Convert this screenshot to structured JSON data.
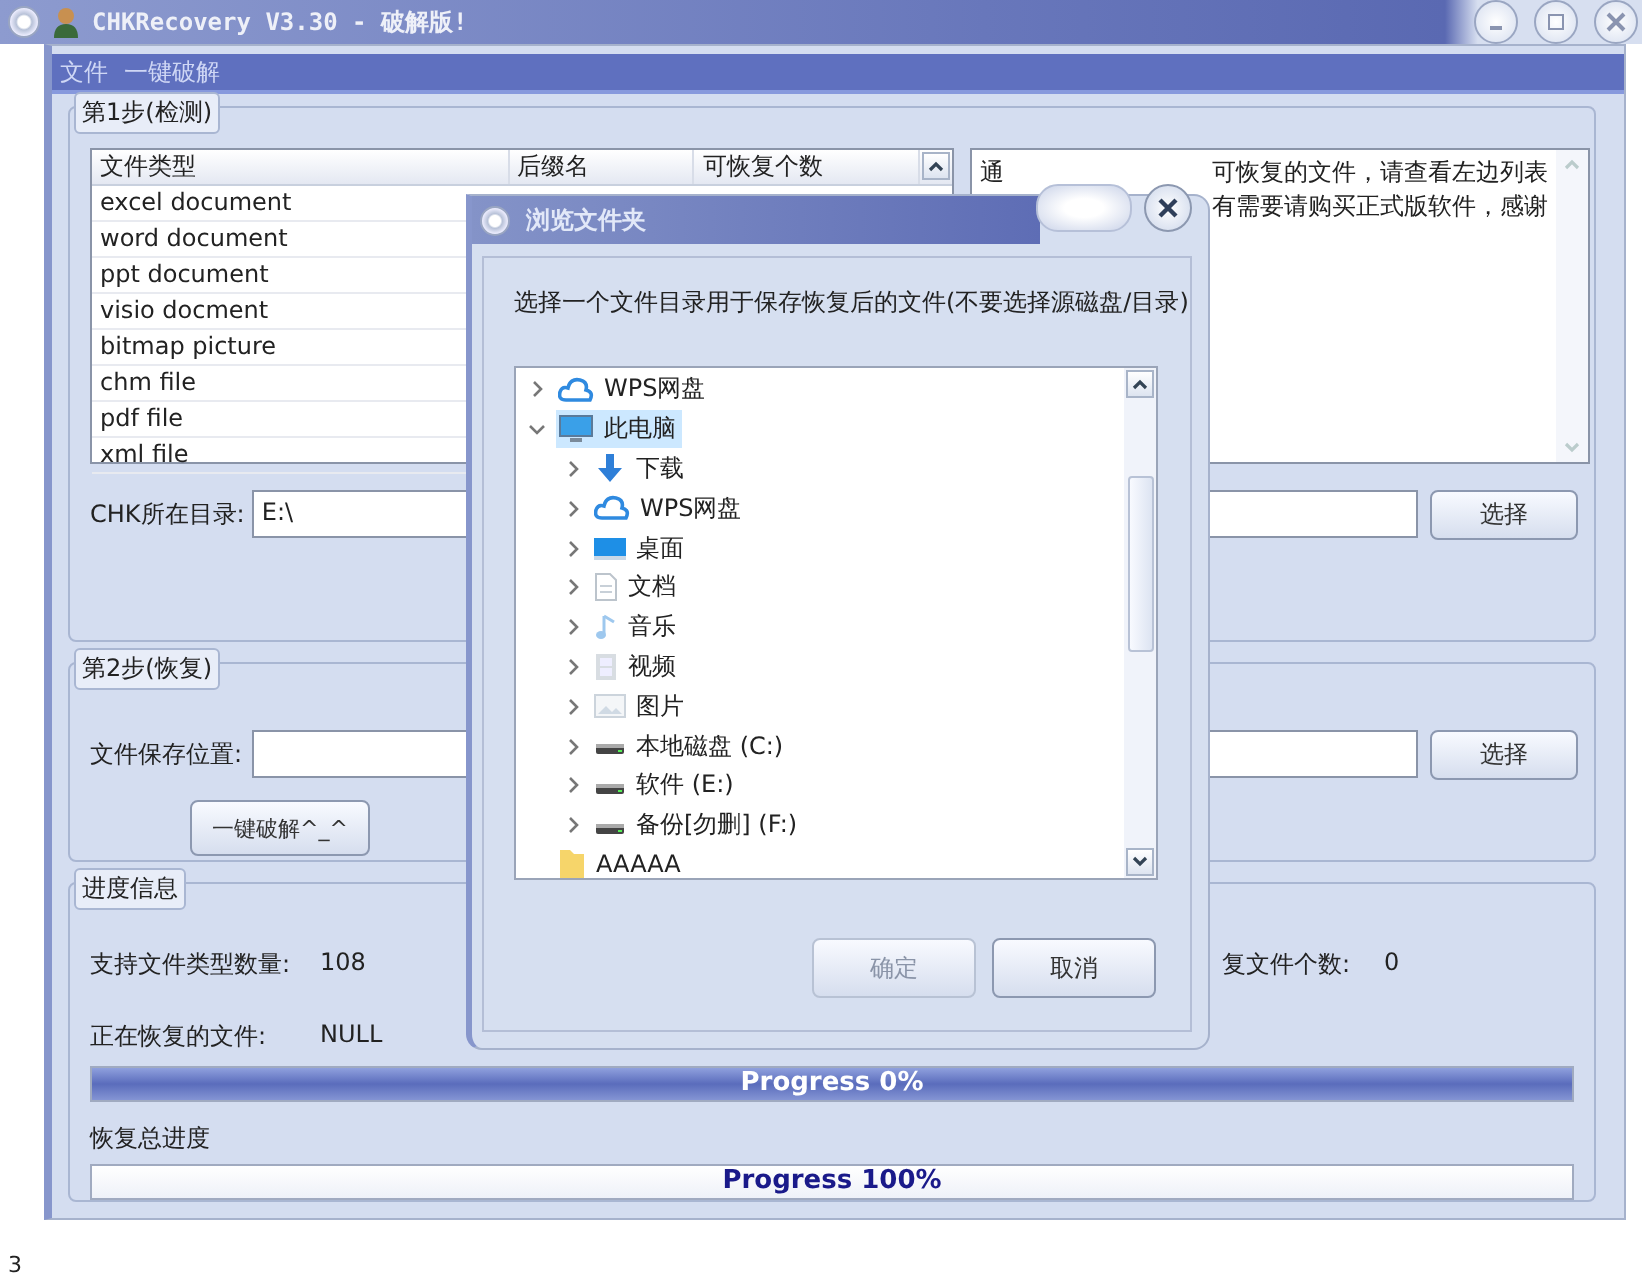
{
  "window": {
    "title": "CHKRecovery V3.30 - 破解版!"
  },
  "menu": [
    "文件",
    "一键破解"
  ],
  "step1": {
    "legend": "第1步(检测)",
    "table": {
      "columns": [
        "文件类型",
        "后缀名",
        "可恢复个数"
      ],
      "rows": [
        "excel document",
        "word document",
        "ppt document",
        "visio docment",
        "bitmap picture",
        "chm file",
        "pdf file",
        "xml file"
      ]
    },
    "info_lines": [
      {
        "left": "通",
        "right": "可恢复的文件，请查看左边列表"
      },
      {
        "right": "有需要请购买正式版软件，感谢"
      }
    ],
    "dir_label": "CHK所在目录:",
    "dir_value": "E:\\",
    "button": "选择"
  },
  "step2": {
    "legend": "第2步(恢复)",
    "save_label": "文件保存位置:",
    "button": "选择",
    "crack_button": "一键破解^_^"
  },
  "progress": {
    "legend": "进度信息",
    "types_label": "支持文件类型数量:",
    "types_value": "108",
    "count_label": "复文件个数:",
    "count_value": "0",
    "current_label": "正在恢复的文件:",
    "current_value": "NULL",
    "total_label": "恢复总进度",
    "bars": [
      {
        "text": "Progress 0%",
        "kind": "filled"
      },
      {
        "text": "Progress 100%",
        "kind": "plain"
      }
    ]
  },
  "dialog": {
    "title": "浏览文件夹",
    "prompt": "选择一个文件目录用于保存恢复后的文件(不要选择源磁盘/目录)",
    "tree": [
      {
        "label": "WPS网盘",
        "kind": "cloud",
        "expanded": false,
        "selected": false
      },
      {
        "label": "此电脑",
        "kind": "computer",
        "expanded": true,
        "selected": true,
        "children": [
          {
            "label": "下载",
            "kind": "download",
            "expanded": false,
            "selected": false
          },
          {
            "label": "WPS网盘",
            "kind": "cloud",
            "expanded": false,
            "selected": false
          },
          {
            "label": "桌面",
            "kind": "desktop",
            "expanded": false,
            "selected": false
          },
          {
            "label": "文档",
            "kind": "document",
            "expanded": false,
            "selected": false
          },
          {
            "label": "音乐",
            "kind": "music",
            "expanded": false,
            "selected": false
          },
          {
            "label": "视频",
            "kind": "video",
            "expanded": false,
            "selected": false
          },
          {
            "label": "图片",
            "kind": "picture",
            "expanded": false,
            "selected": false
          },
          {
            "label": "本地磁盘 (C:)",
            "kind": "drive",
            "expanded": false,
            "selected": false
          },
          {
            "label": "软件 (E:)",
            "kind": "drive",
            "expanded": false,
            "selected": false
          },
          {
            "label": "备份[勿删] (F:)",
            "kind": "drive",
            "expanded": false,
            "selected": false
          }
        ]
      },
      {
        "label": "AAAAA",
        "kind": "folder",
        "selected": false
      }
    ],
    "buttons": [
      {
        "label": "确定",
        "disabled": true
      },
      {
        "label": "取消",
        "disabled": false
      }
    ]
  },
  "page_footer": "3"
}
